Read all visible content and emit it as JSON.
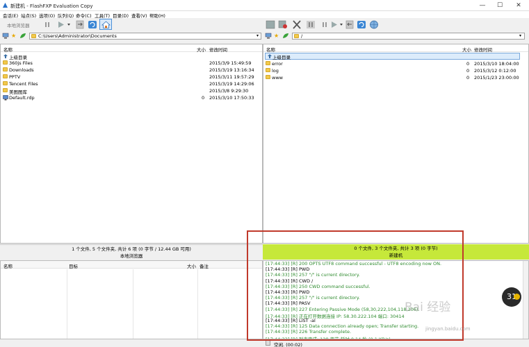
{
  "window": {
    "title": "新建机 - FlashFXP Evaluation Copy",
    "min": "—",
    "max": "☐",
    "close": "✕"
  },
  "menu": [
    "会话(E)",
    "站点(S)",
    "选项(O)",
    "队列(Q)",
    "命令(C)",
    "工具(T)",
    "目录(D)",
    "查看(V)",
    "帮助(H)"
  ],
  "left_toolbar": {
    "local_browser": "本地浏览器"
  },
  "left_address": "C:\\Users\\Administrator\\Documents",
  "right_address": "/",
  "left_pane": {
    "columns": {
      "name": "名称",
      "size": "大小",
      "modified": "修改时间"
    },
    "parent": "上级目录",
    "rows": [
      {
        "name": "360js Files",
        "size": "",
        "modified": "2015/3/9 15:49:59",
        "type": "folder"
      },
      {
        "name": "Downloads",
        "size": "",
        "modified": "2015/3/19 13:16:34",
        "type": "folder"
      },
      {
        "name": "PPTV",
        "size": "",
        "modified": "2015/3/11 19:57:29",
        "type": "folder"
      },
      {
        "name": "Tencent Files",
        "size": "",
        "modified": "2015/3/19 14:29:06",
        "type": "folder"
      },
      {
        "name": "美图图库",
        "size": "",
        "modified": "2015/3/8 9:29:30",
        "type": "folder"
      },
      {
        "name": "Default.rdp",
        "size": "0",
        "modified": "2015/3/10 17:50:33",
        "type": "file"
      }
    ],
    "status1": "1 个文件, 5 个文件夹, 共计 6 项 (0 字节 / 12.44 GB 可用)",
    "status2": "本地浏览器"
  },
  "right_pane": {
    "columns": {
      "name": "名称",
      "size": "大小",
      "modified": "修改时间"
    },
    "parent": "上级目录",
    "rows": [
      {
        "name": "error",
        "size": "0",
        "modified": "2015/3/10 18:04:00",
        "type": "folder"
      },
      {
        "name": "log",
        "size": "0",
        "modified": "2015/3/12 0:12:00",
        "type": "folder"
      },
      {
        "name": "www",
        "size": "0",
        "modified": "2015/1/23 23:00:00",
        "type": "folder"
      }
    ],
    "status1": "0 个文件, 3 个文件夹, 共计 3 项 (0 字节)",
    "status2": "新建机",
    "status_color": "#c6e83a"
  },
  "queue": {
    "columns": {
      "name": "名称",
      "target": "目标",
      "size": "大小",
      "note": "备注"
    }
  },
  "log": [
    {
      "text": "[17:44:33] [R] 200 OPTS UTF8 command successful - UTF8 encoding now ON.",
      "color": "#2e8b2e"
    },
    {
      "text": "[17:44:33] [R] PWD",
      "color": "#000000"
    },
    {
      "text": "[17:44:33] [R] 257 \"/\" is current directory.",
      "color": "#2e8b2e"
    },
    {
      "text": "[17:44:33] [R] CWD /",
      "color": "#000000"
    },
    {
      "text": "[17:44:33] [R] 250 CWD command successful.",
      "color": "#2e8b2e"
    },
    {
      "text": "[17:44:33] [R] PWD",
      "color": "#000000"
    },
    {
      "text": "[17:44:33] [R] 257 \"/\" is current directory.",
      "color": "#2e8b2e"
    },
    {
      "text": "[17:44:33] [R] PASV",
      "color": "#000000"
    },
    {
      "text": "[17:44:33] [R] 227 Entering Passive Mode (58,30,222,104,118,206).",
      "color": "#2e8b2e"
    },
    {
      "text": "[17:44:33] [R] 正在打开数据连接 IP: 58.30.222.104 端口: 30414",
      "color": "#2e8b2e"
    },
    {
      "text": "[17:44:33] [R] LIST -al",
      "color": "#000000"
    },
    {
      "text": "[17:44:33] [R] 125 Data connection already open; Transfer starting.",
      "color": "#2e8b2e"
    },
    {
      "text": "[17:44:33] [R] 226 Transfer complete.",
      "color": "#2e8b2e"
    },
    {
      "text": "[17:44:33] [R] 列表完成: 128 字节 耗时 0.14 秒 (0.1 KB/s)",
      "color": "#2e8b2e"
    }
  ],
  "bottom_status": "空闲. (00:02)",
  "highlight_color": "#c0392b",
  "floating_badge": "31",
  "watermark": {
    "brand": "Bai 经验",
    "url": "jingyan.baidu.com"
  }
}
